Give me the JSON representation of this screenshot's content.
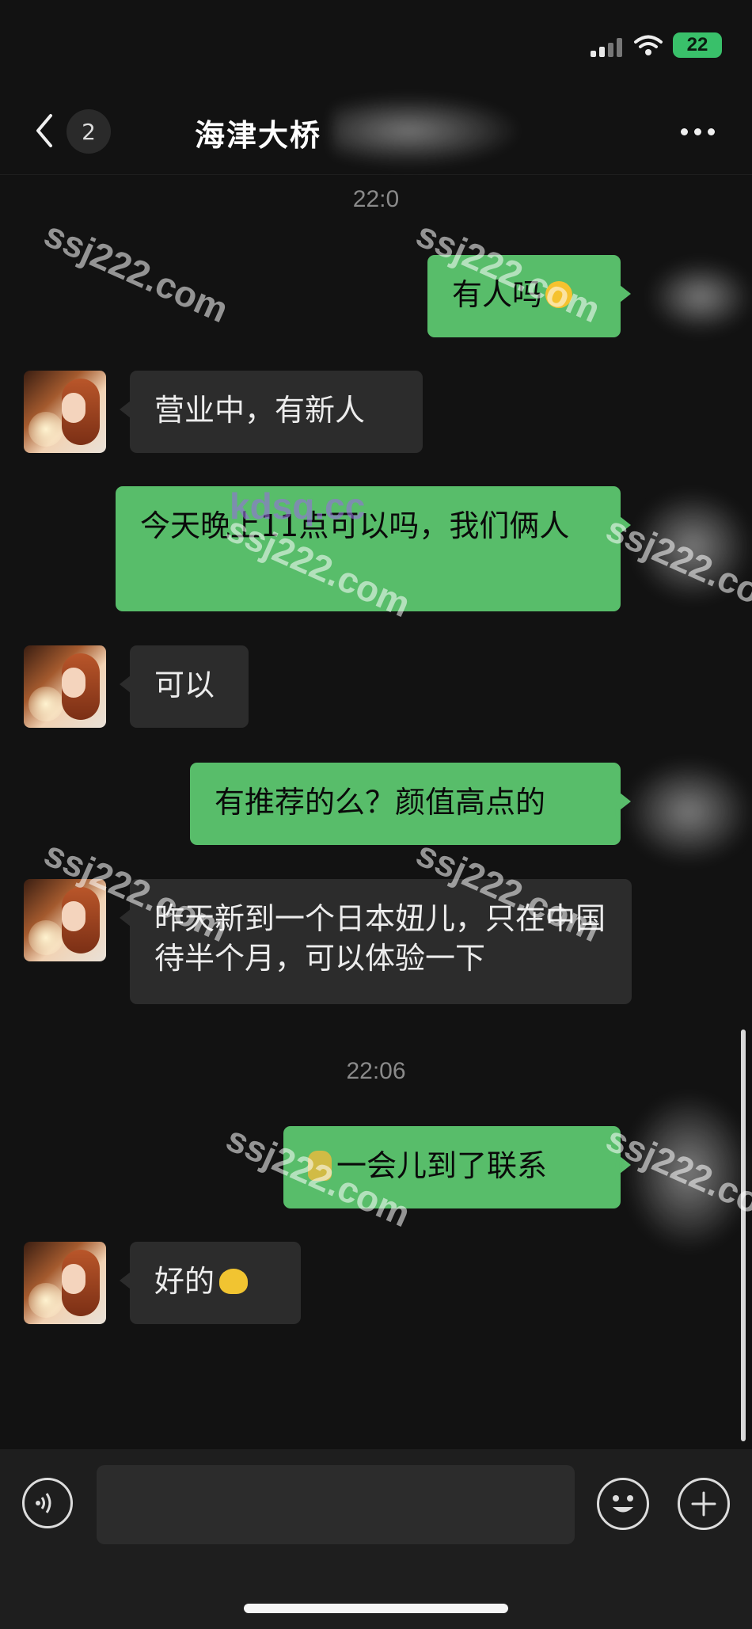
{
  "status_bar": {
    "battery": "22"
  },
  "header": {
    "badge": "2",
    "title": "海津大桥"
  },
  "messages": [
    {
      "type": "time",
      "text": "22:0"
    },
    {
      "type": "out",
      "text": "有人吗"
    },
    {
      "type": "in",
      "text": "营业中，有新人"
    },
    {
      "type": "out",
      "text": "今天晚上11点可以吗，我们俩人"
    },
    {
      "type": "in",
      "text": "可以"
    },
    {
      "type": "out",
      "text": "有推荐的么？颜值高点的"
    },
    {
      "type": "in",
      "text": "昨天新到一个日本妞儿，只在中国待半个月，可以体验一下"
    },
    {
      "type": "time",
      "text": "22:06"
    },
    {
      "type": "out",
      "text": "一会儿到了联系"
    },
    {
      "type": "in",
      "text": "好的"
    }
  ],
  "watermark": {
    "text": "ssj222.com",
    "text2": "kdsq.cc"
  },
  "icons": [
    "back-icon",
    "more-icon",
    "wifi-icon",
    "voice-icon",
    "emoji-icon",
    "plus-icon"
  ],
  "colors": {
    "out_bubble": "#58bd6a",
    "in_bubble": "#2c2c2c",
    "background": "#121212"
  }
}
